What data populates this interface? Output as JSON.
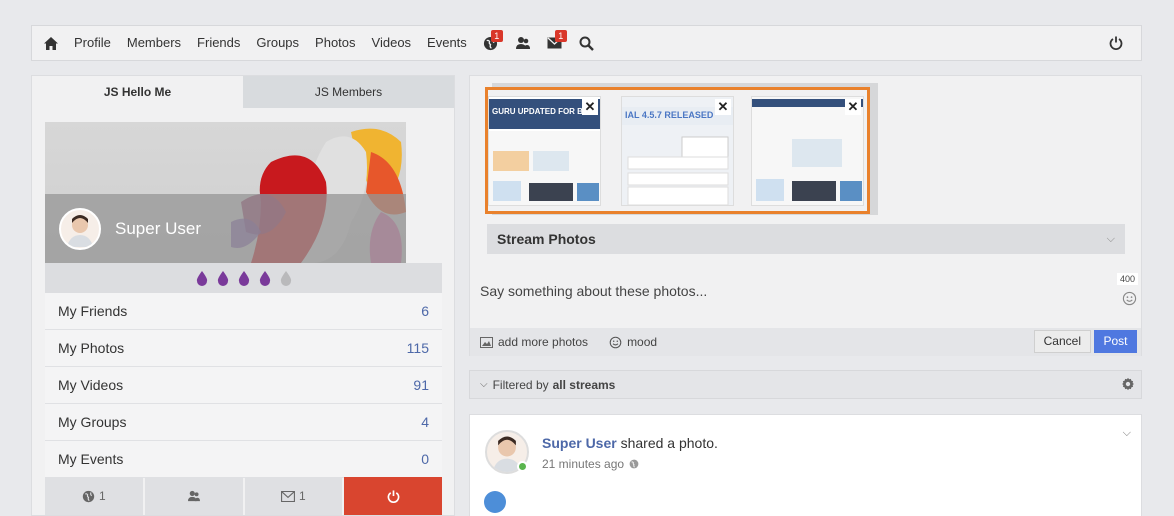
{
  "nav": {
    "links": [
      "Profile",
      "Members",
      "Friends",
      "Groups",
      "Photos",
      "Videos",
      "Events"
    ],
    "globe_badge": "1",
    "mail_badge": "1"
  },
  "sidebar": {
    "tabs": [
      "JS Hello Me",
      "JS Members"
    ],
    "user_name": "Super User",
    "karma_total": 5,
    "karma_filled": 4,
    "stats": [
      {
        "label": "My Friends",
        "count": "6"
      },
      {
        "label": "My Photos",
        "count": "115"
      },
      {
        "label": "My Videos",
        "count": "91"
      },
      {
        "label": "My Groups",
        "count": "4"
      },
      {
        "label": "My Events",
        "count": "0"
      }
    ],
    "bottom": {
      "globe_count": "1",
      "mail_count": "1"
    }
  },
  "composer": {
    "thumbs": [
      {
        "banner": "GURU UPDATED FOR BUG"
      },
      {
        "banner": "IAL 4.5.7 RELEASED"
      },
      {
        "banner": ""
      }
    ],
    "album": "Stream Photos",
    "char_counter": "400",
    "placeholder": "Say something about these photos...",
    "add_more": "add more photos",
    "mood": "mood",
    "cancel": "Cancel",
    "post": "Post"
  },
  "filter": {
    "prefix": "Filtered by",
    "value": "all streams"
  },
  "post": {
    "author": "Super User",
    "action": "shared a photo.",
    "time": "21 minutes ago"
  },
  "colors": {
    "accent": "#4f78e0",
    "danger": "#d9452f",
    "selection": "#e9812c",
    "link": "#4d68a8"
  }
}
